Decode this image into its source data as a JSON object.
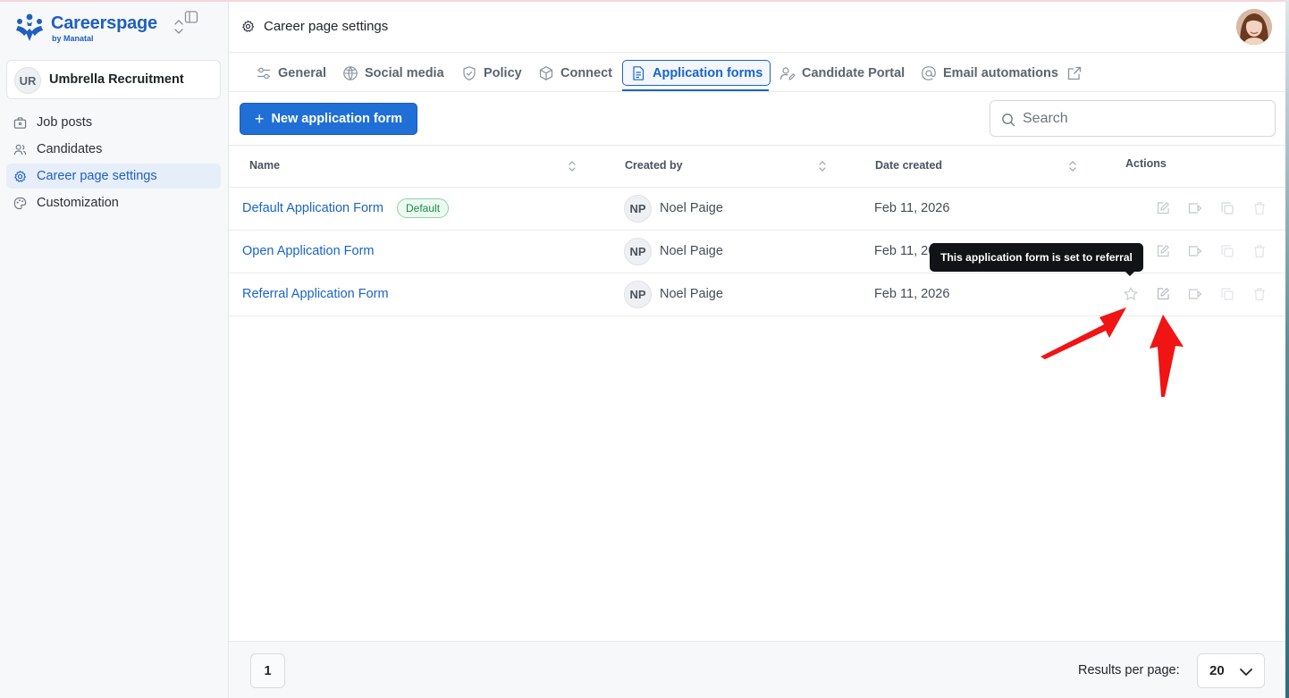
{
  "app": {
    "brand_name": "Careerspage",
    "brand_sub": "by Manatal",
    "org_initials": "UR",
    "org_name": "Umbrella Recruitment",
    "accent_color": "#1f6fd6"
  },
  "sidebar": {
    "items": [
      {
        "label": "Job posts",
        "icon": "briefcase-icon"
      },
      {
        "label": "Candidates",
        "icon": "users-icon"
      },
      {
        "label": "Career page settings",
        "icon": "gear-icon",
        "active": true
      },
      {
        "label": "Customization",
        "icon": "palette-icon"
      }
    ]
  },
  "header": {
    "title": "Career page settings"
  },
  "tabs": [
    {
      "label": "General",
      "icon": "sliders-icon"
    },
    {
      "label": "Social media",
      "icon": "globe-icon"
    },
    {
      "label": "Policy",
      "icon": "shield-icon"
    },
    {
      "label": "Connect",
      "icon": "cube-icon"
    },
    {
      "label": "Application forms",
      "icon": "form-icon",
      "active": true
    },
    {
      "label": "Candidate Portal",
      "icon": "user-edit-icon"
    },
    {
      "label": "Email automations",
      "icon": "at-icon"
    }
  ],
  "toolbar": {
    "new_form_label": "New application form",
    "search_placeholder": "Search"
  },
  "table": {
    "columns": {
      "name": "Name",
      "created_by": "Created by",
      "date_created": "Date created",
      "actions": "Actions"
    },
    "rows": [
      {
        "name": "Default Application Form",
        "badge": "Default",
        "creator_initials": "NP",
        "creator": "Noel Paige",
        "date": "Feb 11, 2026"
      },
      {
        "name": "Open Application Form",
        "creator_initials": "NP",
        "creator": "Noel Paige",
        "date": "Feb 11, 2026"
      },
      {
        "name": "Referral Application Form",
        "creator_initials": "NP",
        "creator": "Noel Paige",
        "date": "Feb 11, 2026"
      }
    ]
  },
  "tooltip": {
    "text": "This application form is set to referral"
  },
  "footer": {
    "page": "1",
    "results_per_page_label": "Results per page:",
    "results_per_page_value": "20"
  }
}
